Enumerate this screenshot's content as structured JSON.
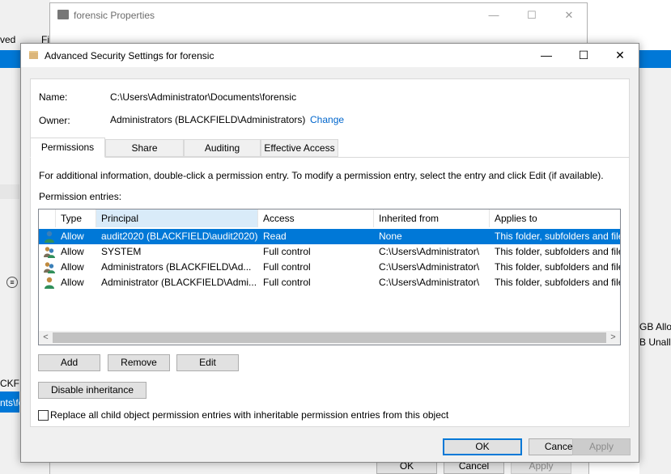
{
  "background": {
    "fragments": {
      "left_top": "ved",
      "left_mid": "Fi",
      "left_blackfield": "CKFI",
      "left_selected": "nts\\fo",
      "right_alloc": "GB Alloc",
      "right_unalloc": "B Unallo"
    },
    "properties_window": {
      "title": "forensic Properties",
      "minimize_icon": "—",
      "maximize_icon": "☐",
      "close_icon": "✕",
      "buttons": {
        "ok": "OK",
        "cancel": "Cancel",
        "apply": "Apply"
      }
    }
  },
  "dialog": {
    "title": "Advanced Security Settings for forensic",
    "caption": {
      "minimize": "—",
      "maximize": "☐",
      "close": "✕"
    },
    "name_label": "Name:",
    "name_value": "C:\\Users\\Administrator\\Documents\\forensic",
    "owner_label": "Owner:",
    "owner_value": "Administrators (BLACKFIELD\\Administrators)",
    "change_link": "Change",
    "tabs": [
      {
        "label": "Permissions",
        "active": true
      },
      {
        "label": "Share",
        "active": false
      },
      {
        "label": "Auditing",
        "active": false
      },
      {
        "label": "Effective Access",
        "active": false
      }
    ],
    "info_text": "For additional information, double-click a permission entry. To modify a permission entry, select the entry and click Edit (if available).",
    "entries_label": "Permission entries:",
    "columns": [
      "Type",
      "Principal",
      "Access",
      "Inherited from",
      "Applies to"
    ],
    "sorted_column": "Principal",
    "rows": [
      {
        "type": "Allow",
        "principal": "audit2020 (BLACKFIELD\\audit2020)",
        "access": "Read",
        "inherited": "None",
        "applies": "This folder, subfolders and files",
        "selected": true,
        "icon": "user-icon"
      },
      {
        "type": "Allow",
        "principal": "SYSTEM",
        "access": "Full control",
        "inherited": "C:\\Users\\Administrator\\",
        "applies": "This folder, subfolders and files",
        "selected": false,
        "icon": "group-icon"
      },
      {
        "type": "Allow",
        "principal": "Administrators (BLACKFIELD\\Ad...",
        "access": "Full control",
        "inherited": "C:\\Users\\Administrator\\",
        "applies": "This folder, subfolders and files",
        "selected": false,
        "icon": "group-icon"
      },
      {
        "type": "Allow",
        "principal": "Administrator (BLACKFIELD\\Admi...",
        "access": "Full control",
        "inherited": "C:\\Users\\Administrator\\",
        "applies": "This folder, subfolders and files",
        "selected": false,
        "icon": "user-icon"
      }
    ],
    "scroll_left": "<",
    "scroll_right": ">",
    "buttons": {
      "add": "Add",
      "remove": "Remove",
      "edit": "Edit",
      "disable_inheritance": "Disable inheritance"
    },
    "replace_checkbox": {
      "label": "Replace all child object permission entries with inheritable permission entries from this object",
      "checked": false
    },
    "footer": {
      "ok": "OK",
      "cancel": "Cancel",
      "apply": "Apply"
    },
    "colors": {
      "accent": "#0078d7",
      "link": "#0066cc",
      "selected_row": "#0078d7"
    }
  }
}
